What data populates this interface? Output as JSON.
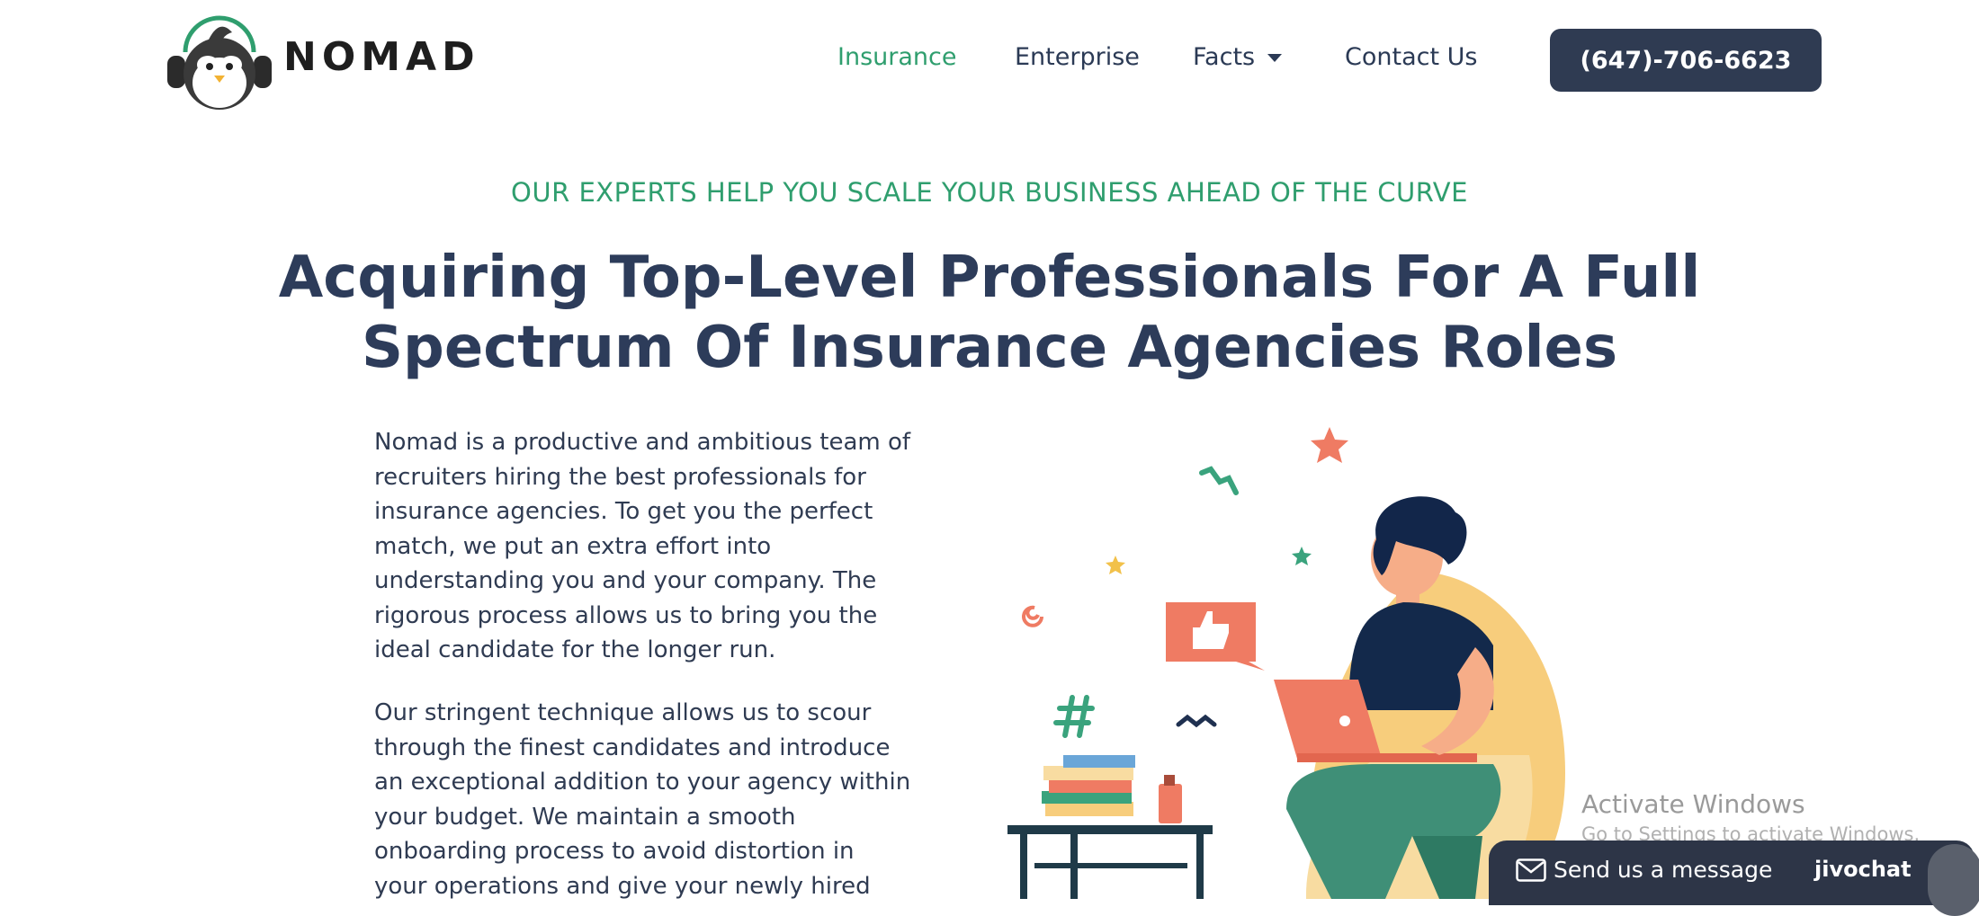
{
  "header": {
    "brand": "NOMAD",
    "nav": [
      {
        "label": "Insurance"
      },
      {
        "label": "Enterprise"
      },
      {
        "label": "Facts"
      },
      {
        "label": "Contact Us"
      }
    ],
    "phone": "(647)-706-6623",
    "accent_color": "#2f9e6e",
    "dark_color": "#2f3b52"
  },
  "hero": {
    "eyebrow": "OUR EXPERTS HELP YOU SCALE YOUR BUSINESS AHEAD OF THE CURVE",
    "headline_line1": "Acquiring Top-Level Professionals For A Full",
    "headline_line2": "Spectrum Of Insurance Agencies Roles",
    "paragraph1": "Nomad is a productive and ambitious team of recruiters hiring the best professionals for insurance agencies. To get you the perfect match, we put an extra effort into understanding you and your company. The rigorous process allows us to bring you the ideal candidate for the longer run.",
    "paragraph2": "Our stringent technique allows us to scour through the finest candidates and introduce an exceptional addition to your agency within your budget. We maintain a smooth onboarding process to avoid distortion in your operations and give your newly hired"
  },
  "watermark": {
    "title": "Activate Windows",
    "subtitle": "Go to Settings to activate Windows."
  },
  "chat": {
    "label": "Send us a message",
    "brand": "jivochat"
  }
}
